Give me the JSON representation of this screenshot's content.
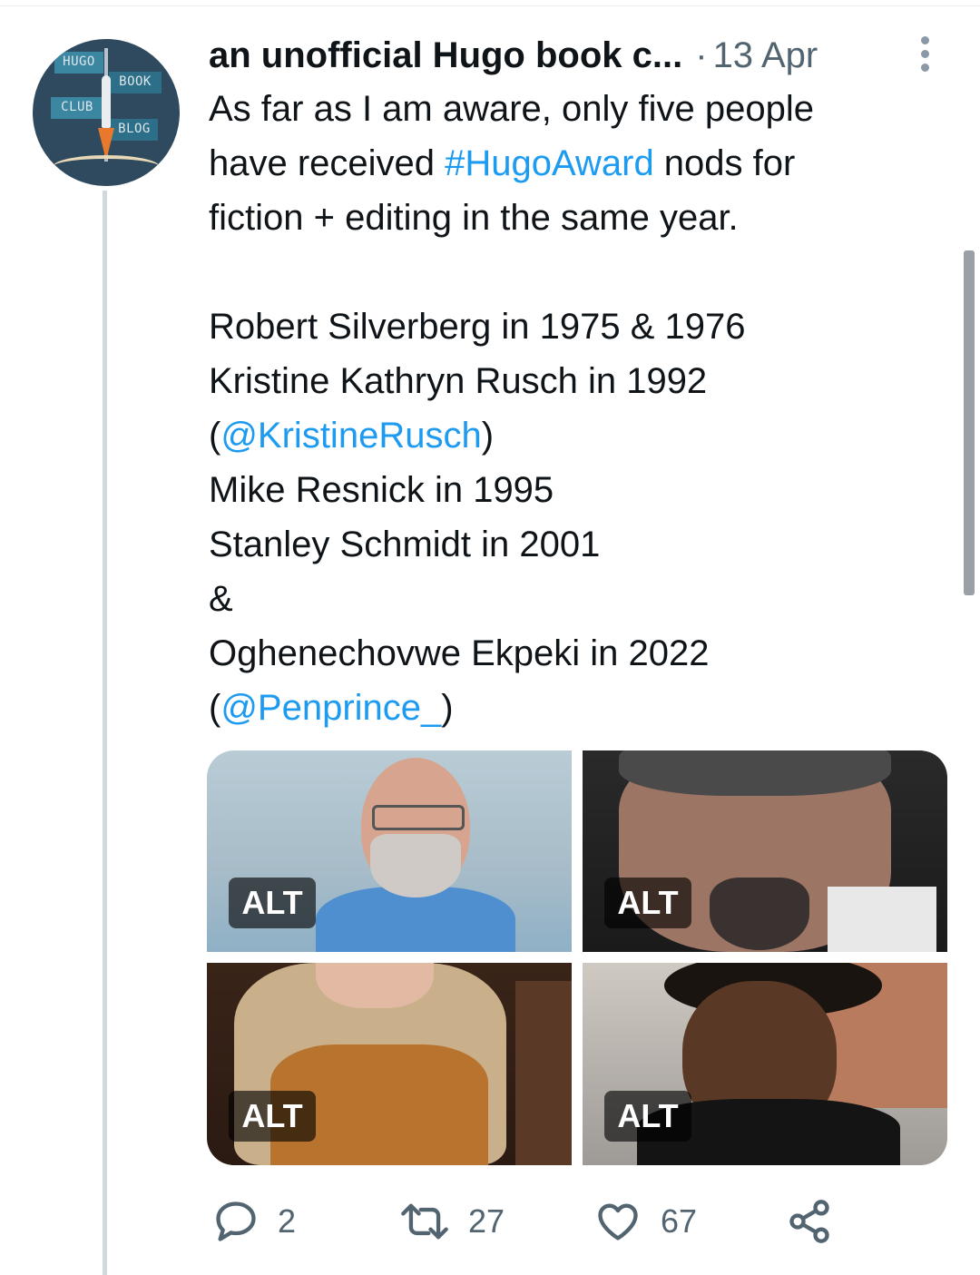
{
  "tweet": {
    "display_name": "an unofficial Hugo book c...",
    "separator": "·",
    "timestamp": "13 Apr",
    "avatar_text": {
      "sign1": "HUGO",
      "sign2": "BOOK",
      "sign3": "CLUB",
      "sign4": "BLOG"
    },
    "line1": "As far as I am aware, only five people",
    "line2_pre": "have received ",
    "hashtag": "#HugoAward",
    "line2_post": " nods for",
    "line3": "fiction + editing in the same year.",
    "list": {
      "l1": "Robert Silverberg in 1975 & 1976",
      "l2": "Kristine Kathryn Rusch in 1992",
      "l3_open": "(",
      "mention1": "@KristineRusch",
      "l3_close": ")",
      "l4": "Mike Resnick in 1995",
      "l5": "Stanley Schmidt in 2001",
      "l6": "&",
      "l7": "Oghenechovwe Ekpeki in 2022",
      "l8_open": "(",
      "mention2": "@Penprince_",
      "l8_close": ")"
    }
  },
  "media": {
    "alt_label": "ALT"
  },
  "actions": {
    "replies": "2",
    "retweets": "27",
    "likes": "67"
  },
  "colors": {
    "link": "#1d9bf0",
    "muted": "#536471",
    "text": "#0f1419"
  },
  "icons": {
    "reply": "reply-icon",
    "retweet": "retweet-icon",
    "like": "heart-icon",
    "share": "share-icon",
    "more": "more-icon"
  }
}
